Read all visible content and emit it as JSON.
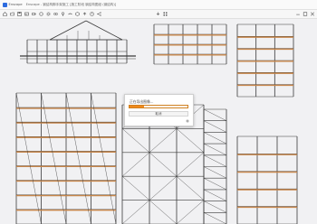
{
  "app": {
    "name": "Enscape",
    "window_title": "Enscape - 钢结构脚手架施工 [施工阶段 钢结构图纸 (钢结构)]"
  },
  "toolbar": {
    "buttons": [
      "home-icon",
      "folder-icon",
      "save-icon",
      "image-icon",
      "video-icon",
      "panorama-icon",
      "settings-icon",
      "view-icon",
      "light-icon",
      "atmosphere-icon",
      "asset-icon",
      "upload-icon",
      "help-icon",
      "share-icon",
      "export-icon",
      "batch-icon"
    ],
    "window_controls": [
      "minimize-icon",
      "maximize-icon",
      "close-icon"
    ]
  },
  "dialog": {
    "title": "正在导出图像...",
    "progress": 0.25,
    "cancel_label": "取消",
    "settings_icon": "gear-icon"
  },
  "colors": {
    "accent": "#f08a1c",
    "steel": "#3a3a3a",
    "plank": "#c8864a"
  }
}
